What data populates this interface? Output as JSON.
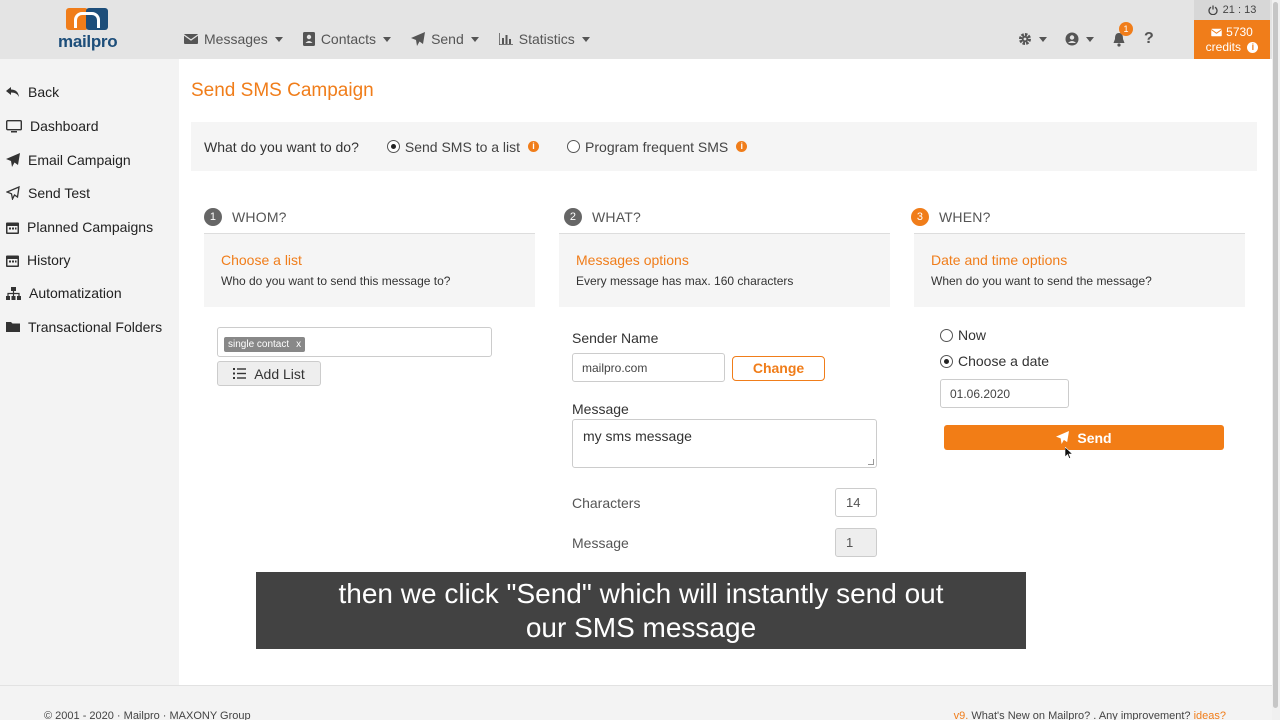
{
  "header": {
    "logo_text": "mailpro",
    "nav": [
      {
        "label": "Messages",
        "icon": "envelope-icon"
      },
      {
        "label": "Contacts",
        "icon": "contact-card-icon"
      },
      {
        "label": "Send",
        "icon": "paper-plane-icon"
      },
      {
        "label": "Statistics",
        "icon": "bar-chart-icon"
      }
    ],
    "notifications_count": "1",
    "help": "?",
    "clock": "21 : 13",
    "credits_amount": "5730",
    "credits_label": "credits"
  },
  "sidebar": {
    "items": [
      {
        "label": "Back",
        "icon": "back-arrow-icon"
      },
      {
        "label": "Dashboard",
        "icon": "monitor-icon"
      },
      {
        "label": "Email Campaign",
        "icon": "paper-plane-icon"
      },
      {
        "label": "Send Test",
        "icon": "paper-plane-outline-icon"
      },
      {
        "label": "Planned Campaigns",
        "icon": "calendar-icon"
      },
      {
        "label": "History",
        "icon": "calendar-icon"
      },
      {
        "label": "Automatization",
        "icon": "sitemap-icon"
      },
      {
        "label": "Transactional Folders",
        "icon": "folder-icon"
      }
    ]
  },
  "main": {
    "title": "Send SMS Campaign",
    "question": "What do you want to do?",
    "options": [
      {
        "label": "Send SMS to a list",
        "selected": true
      },
      {
        "label": "Program frequent SMS",
        "selected": false
      }
    ],
    "steps": [
      {
        "num": "1",
        "label": "WHOM?",
        "card_title": "Choose a list",
        "card_sub": "Who do you want to send this message to?"
      },
      {
        "num": "2",
        "label": "WHAT?",
        "card_title": "Messages options",
        "card_sub": "Every message has max. 160 characters"
      },
      {
        "num": "3",
        "label": "WHEN?",
        "card_title": "Date and time options",
        "card_sub": "When do you want to send the message?"
      }
    ],
    "whom": {
      "tag": "single contact",
      "tag_remove": "x",
      "add_list": "Add List"
    },
    "what": {
      "sender_label": "Sender Name",
      "sender_value": "mailpro.com",
      "change": "Change",
      "message_label": "Message",
      "message_value": "my sms message",
      "characters_label": "Characters",
      "characters_value": "14",
      "message_count_label": "Message",
      "message_count_value": "1"
    },
    "when": {
      "now": "Now",
      "choose_date": "Choose a date",
      "date_value": "01.06.2020",
      "send": "Send"
    }
  },
  "footer": {
    "copyright": "© 2001 - 2020 · Mailpro · MAXONY Group",
    "version": "v9.",
    "whats_new": " What's New on Mailpro? . Any improvement? ",
    "ideas": "ideas?"
  },
  "subtitle": {
    "line1": "then we click \"Send\" which will instantly send out",
    "line2": "our SMS message"
  },
  "colors": {
    "accent": "#f07d1a",
    "brand_blue": "#1d4e7a",
    "sidebar_bg": "#f3f3f3",
    "topbar_bg": "#e4e4e4"
  }
}
